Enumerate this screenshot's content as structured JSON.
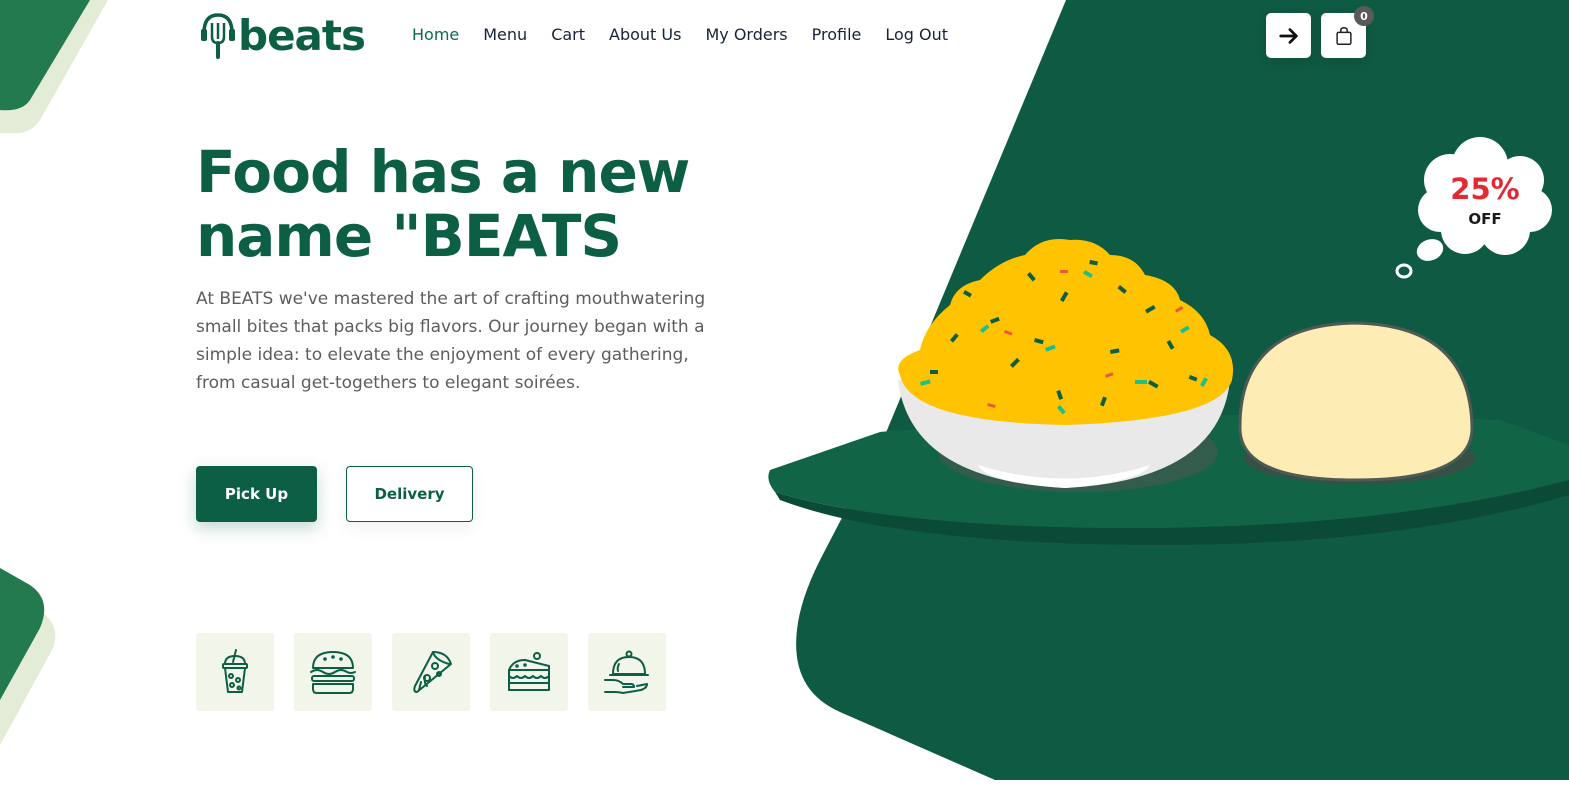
{
  "brand": {
    "name": "beats"
  },
  "nav": {
    "items": [
      {
        "label": "Home",
        "active": true
      },
      {
        "label": "Menu"
      },
      {
        "label": "Cart"
      },
      {
        "label": "About Us"
      },
      {
        "label": "My Orders"
      },
      {
        "label": "Profile"
      },
      {
        "label": "Log Out"
      }
    ]
  },
  "header": {
    "login_icon": "arrow-right-icon",
    "cart_icon": "shopping-bag-icon",
    "cart_count": "0"
  },
  "hero": {
    "title_line1": "Food has a new",
    "title_line2": "name \"BEATS",
    "description": "At BEATS we've mastered the art of crafting mouthwatering small bites that packs big flavors. Our journey began with a simple idea: to elevate the enjoyment of every gathering, from casual get-togethers to elegant soirées.",
    "buttons": {
      "pickup": "Pick Up",
      "delivery": "Delivery"
    }
  },
  "categories": [
    {
      "icon": "drink-icon"
    },
    {
      "icon": "burger-icon"
    },
    {
      "icon": "pizza-icon"
    },
    {
      "icon": "cake-icon"
    },
    {
      "icon": "serving-cloche-icon"
    }
  ],
  "promo": {
    "percent": "25%",
    "label": "OFF"
  },
  "colors": {
    "brand_green": "#0c5f44",
    "dark_green": "#0f5a43",
    "promo_red": "#e02b35",
    "food_yellow": "#ffc300",
    "category_bg": "#f1f5ea"
  }
}
